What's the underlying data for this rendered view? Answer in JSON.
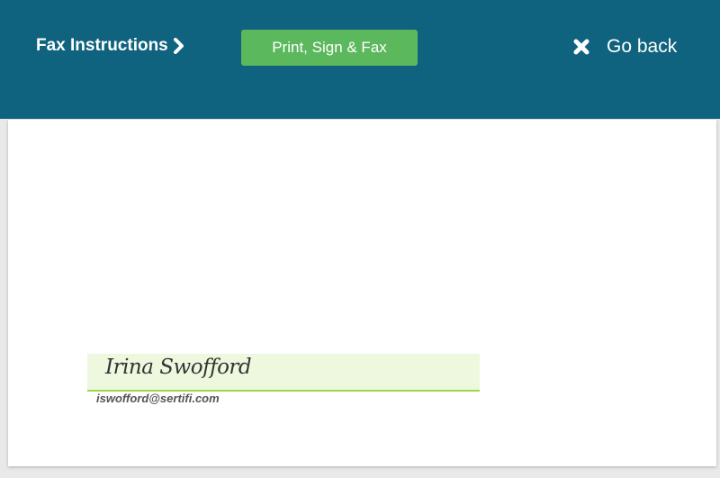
{
  "header": {
    "title": "Fax Instructions",
    "title_icon": "chevron-right-icon",
    "print_button_label": "Print, Sign & Fax",
    "go_back_label": "Go back",
    "go_back_icon": "close-icon"
  },
  "document": {
    "signature": {
      "name": "Irina Swofford",
      "email": "iswofford@sertifi.com"
    }
  },
  "colors": {
    "header_background": "#10637e",
    "print_button": "#5cb85c",
    "signature_background": "#eef8de",
    "signature_underline": "#9ed848"
  }
}
